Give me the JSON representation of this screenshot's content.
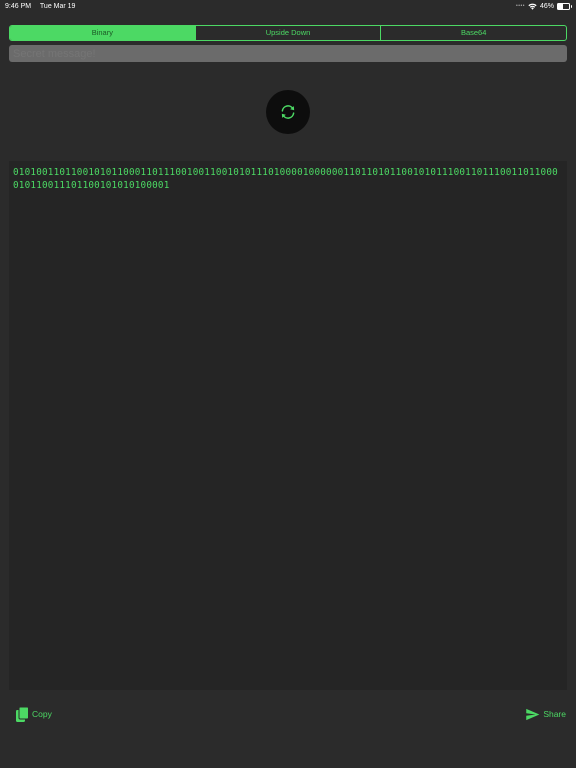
{
  "status_bar": {
    "time": "9:46 PM",
    "date": "Tue Mar 19",
    "battery": "46%",
    "battery_level": 0.46,
    "icons": [
      "signal-dots-icon",
      "wifi-icon",
      "battery-icon"
    ]
  },
  "modes": [
    {
      "label": "Binary",
      "selected": true
    },
    {
      "label": "Upside Down",
      "selected": false
    },
    {
      "label": "Base64",
      "selected": false
    }
  ],
  "input": {
    "value": "",
    "placeholder": "Secret message!"
  },
  "convert_button": {
    "icon": "refresh-icon"
  },
  "output": {
    "text": "0101001101100101011000110111001001100101011101000010000001101101011001010111001101110011011000010110011101100101010100001"
  },
  "actions": {
    "copy_label": "Copy",
    "copy_icon": "copy-icon",
    "share_label": "Share",
    "share_icon": "send-icon"
  },
  "colors": {
    "accent": "#4cd964",
    "background": "#2b2b2b",
    "output_background": "#252525",
    "input_background": "#6b6b6b",
    "button_background": "#0d0d0d"
  }
}
